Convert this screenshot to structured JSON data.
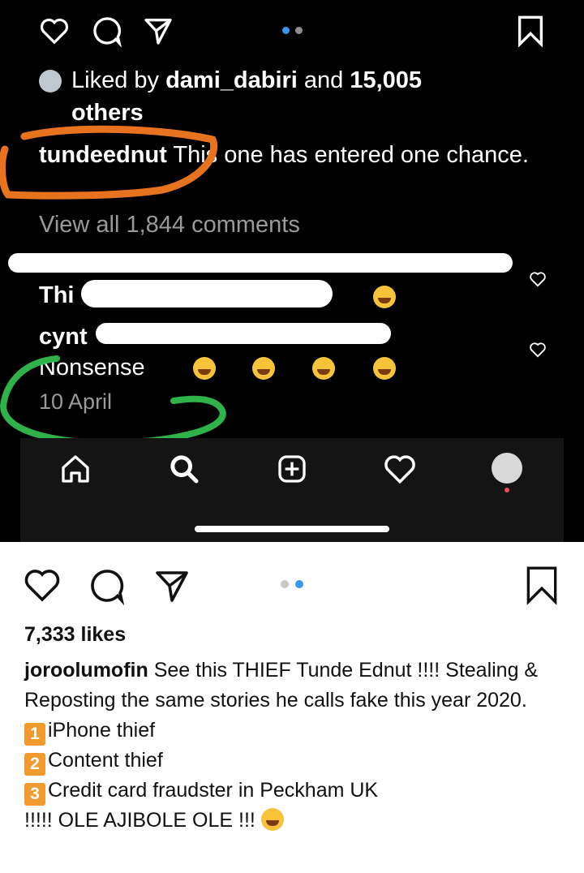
{
  "screenshot": {
    "liked_prefix": "Liked by ",
    "liked_user": "dami_dabiri",
    "liked_and": " and ",
    "liked_count": "15,005",
    "liked_others": "others",
    "comment_user": "tundeednut",
    "comment_text": " This one has entered one chance.",
    "view_all": "View all 1,844 comments",
    "c1_partial": "Thi",
    "c2_partial": "cynt",
    "c2_line2": "Nonsense",
    "date": "10 April"
  },
  "post": {
    "likes": "7,333 likes",
    "username": "joroolumofin",
    "caption_line1": " See this THIEF Tunde Ednut !!!! Stealing & Reposting the same stories he calls fake this year 2020.",
    "item1_num": "1",
    "item1": "iPhone thief",
    "item2_num": "2",
    "item2": "Content thief",
    "item3_num": "3",
    "item3": "Credit card fraudster in Peckham UK",
    "closing": "!!!!! OLE AJIBOLE OLE !!!"
  },
  "colors": {
    "orange_annotation": "#e8731f",
    "green_annotation": "#2fb24a",
    "active_dot": "#3897f0",
    "inactive_dot": "#8e8e8e"
  }
}
